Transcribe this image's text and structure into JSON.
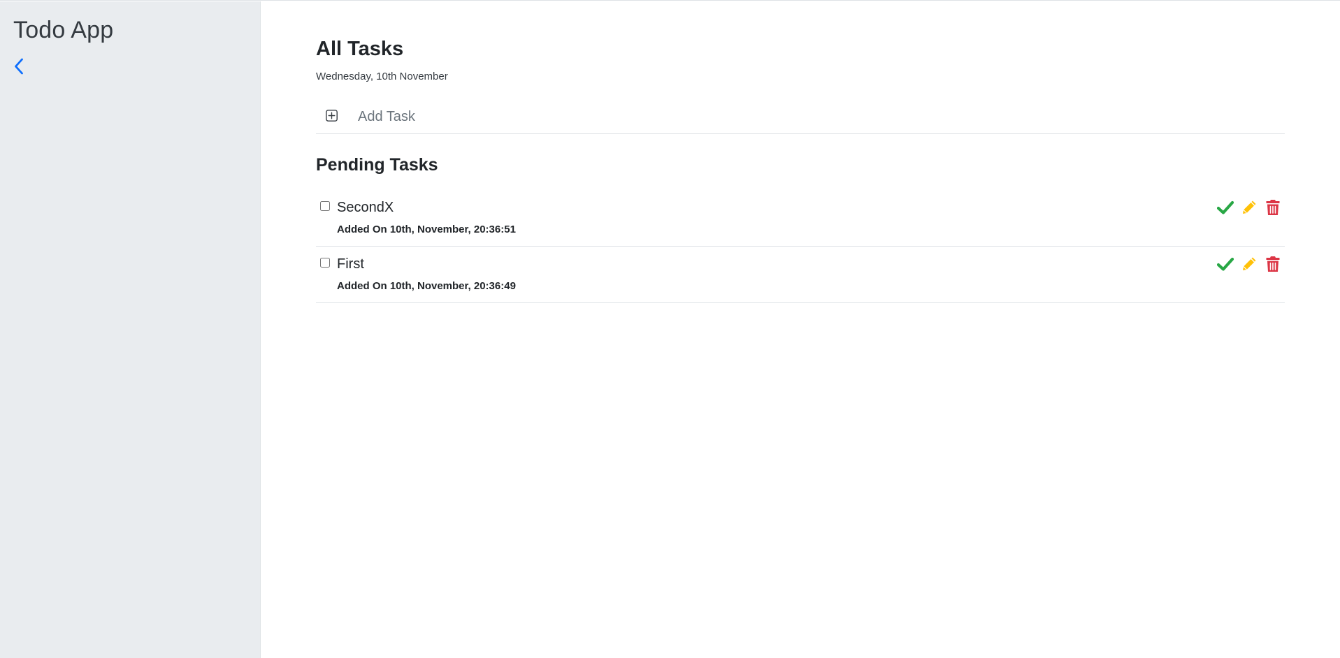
{
  "sidebar": {
    "app_title": "Todo App",
    "back_icon": "chevron-left-icon",
    "accent_color": "#0d6efd"
  },
  "main": {
    "page_title": "All Tasks",
    "date": "Wednesday, 10th November",
    "add_task": {
      "icon": "plus-square-icon",
      "placeholder": "Add Task",
      "value": ""
    },
    "section_title": "Pending Tasks",
    "tasks": [
      {
        "name": "SecondX",
        "added": "Added On 10th, November, 20:36:51",
        "checked": false
      },
      {
        "name": "First",
        "added": "Added On 10th, November, 20:36:49",
        "checked": false
      }
    ],
    "action_icons": {
      "complete": "checkmark-icon",
      "edit": "pencil-icon",
      "delete": "trash-icon"
    },
    "action_colors": {
      "complete": "#28a745",
      "edit": "#ffc107",
      "delete": "#dc3545"
    }
  }
}
